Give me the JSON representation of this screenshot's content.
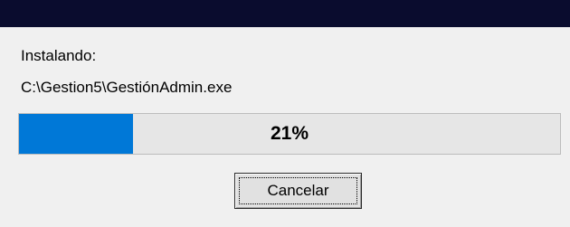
{
  "dialog": {
    "status_label": "Instalando:",
    "file_path": "C:\\Gestion5\\GestiónAdmin.exe"
  },
  "progress": {
    "value": 0.21,
    "text": "21%",
    "fill_color": "#0078d7"
  },
  "buttons": {
    "cancel_label": "Cancelar"
  }
}
